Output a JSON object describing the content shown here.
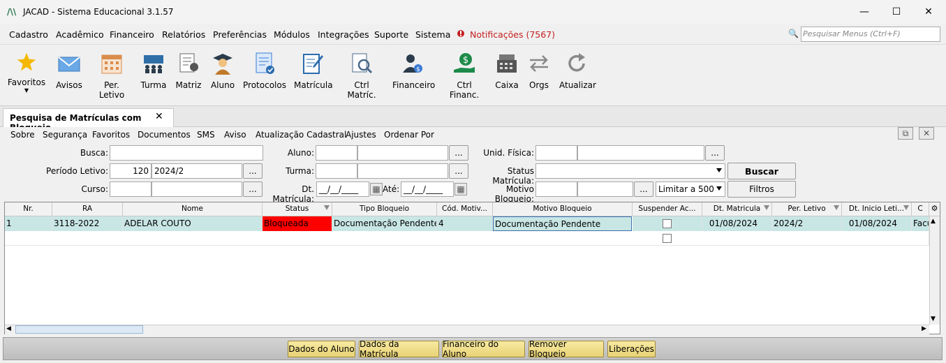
{
  "app": {
    "logo": "/\\\\",
    "title": "JACAD - Sistema Educacional 3.1.57"
  },
  "window_controls": {
    "minimize": "—",
    "maximize": "☐",
    "close": "✕"
  },
  "menu": {
    "items": [
      "Cadastro",
      "Acadêmico",
      "Financeiro",
      "Relatórios",
      "Preferências",
      "Módulos",
      "Integrações",
      "Suporte",
      "Sistema"
    ],
    "notifications": "Notificações (7567)",
    "search_placeholder": "Pesquisar Menus (Ctrl+F)"
  },
  "toolbar": {
    "items": [
      {
        "label": "Favoritos",
        "icon": "star-icon",
        "color": "#f5b800"
      },
      {
        "label": "Avisos",
        "icon": "envelope-icon",
        "color": "#4a8fd6"
      },
      {
        "label": "Per. Letivo",
        "icon": "calendar-icon",
        "color": "#d98c4b"
      },
      {
        "label": "Turma",
        "icon": "class-group-icon",
        "color": "#2f6fa8"
      },
      {
        "label": "Matriz",
        "icon": "curriculum-icon",
        "color": "#555555"
      },
      {
        "label": "Aluno",
        "icon": "student-icon",
        "color": "#2a3b4c"
      },
      {
        "label": "Protocolos",
        "icon": "protocol-document-icon",
        "color": "#3a7bd5"
      },
      {
        "label": "Matrícula",
        "icon": "enrollment-edit-icon",
        "color": "#2b6cb0"
      },
      {
        "label": "Ctrl Matríc.",
        "icon": "enrollment-search-icon",
        "color": "#4a6a8a"
      },
      {
        "label": "Financeiro",
        "icon": "finance-person-icon",
        "color": "#2a3b4c"
      },
      {
        "label": "Ctrl Financ.",
        "icon": "money-hand-icon",
        "color": "#1d8a4a"
      },
      {
        "label": "Caixa",
        "icon": "cash-register-icon",
        "color": "#555555"
      },
      {
        "label": "Orgs",
        "icon": "swap-arrows-icon",
        "color": "#888888"
      },
      {
        "label": "Atualizar",
        "icon": "refresh-icon",
        "color": "#888888"
      }
    ]
  },
  "tab": {
    "label": "Pesquisa de Matrículas com Bloqueio",
    "close": "✕"
  },
  "submenu": {
    "items": [
      "Sobre",
      "Segurança",
      "Favoritos",
      "Documentos",
      "SMS",
      "Aviso",
      "Atualização Cadastral",
      "Ajustes",
      "Ordenar Por"
    ]
  },
  "form": {
    "busca_label": "Busca:",
    "periodo_label": "Período Letivo:",
    "periodo_code": "120",
    "periodo_value": "2024/2",
    "curso_label": "Curso:",
    "aluno_label": "Aluno:",
    "turma_label": "Turma:",
    "dt_matricula_label": "Dt. Matrícula:",
    "dt_placeholder": "__/__/____",
    "ate_label": "Até:",
    "unid_label": "Unid. Física:",
    "status_label": "Status Matrícula:",
    "motivo_label": "Motivo Bloqueio:",
    "limit_value": "Limitar a 500",
    "lookup": "...",
    "buscar": "Buscar",
    "filtros": "Filtros"
  },
  "grid": {
    "columns": [
      "Nr.",
      "RA",
      "Nome",
      "Status",
      "Tipo Bloqueio",
      "Cód. Motiv...",
      "Motivo Bloqueio",
      "Suspender Ac...",
      "Dt. Matricula",
      "Per. Letivo",
      "Dt. Inicio Leti...",
      "C"
    ],
    "rows": [
      {
        "nr": "1",
        "ra": "3118-2022",
        "nome": "ADELAR COUTO",
        "status": "Bloqueada",
        "tipo": "Documentação Pendente",
        "cod": "4",
        "motivo": "Documentação Pendente",
        "dt_matricula": "01/08/2024",
        "per_letivo": "2024/2",
        "dt_inicio": "01/08/2024",
        "extra": "Facu"
      }
    ],
    "status_color": "#ff0000",
    "selected_row_color": "#c8e6e4"
  },
  "footer": {
    "buttons": [
      "Dados do Aluno",
      "Dados da Matrícula",
      "Financeiro do Aluno",
      "Remover Bloqueio",
      "Liberações"
    ]
  }
}
